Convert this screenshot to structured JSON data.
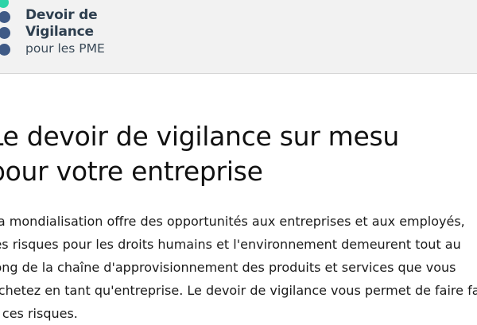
{
  "header": {
    "logo": {
      "line1": "Devoir de",
      "line2": "Vigilance",
      "line3": "pour les PME",
      "dot_colors": [
        "#2dd4a8",
        "#3f5a86",
        "#3f5a86",
        "#3f5a86"
      ]
    }
  },
  "main": {
    "title_lines": [
      "Le devoir de vigilance sur mesu",
      "pour votre entreprise"
    ],
    "intro_lines": [
      "La mondialisation offre des opportunités aux entreprises et aux employés,",
      "les risques pour les droits humains et l'environnement demeurent tout au",
      "long de la chaîne d'approvisionnement des produits et services que vous",
      "achetez en tant qu'entreprise. Le devoir de vigilance vous permet de faire face",
      "à ces risques."
    ]
  },
  "colors": {
    "header_bg": "#f2f2f2",
    "logo_text": "#2e3f4f",
    "accent_green": "#2dd4a8",
    "accent_blue": "#3f5a86"
  }
}
